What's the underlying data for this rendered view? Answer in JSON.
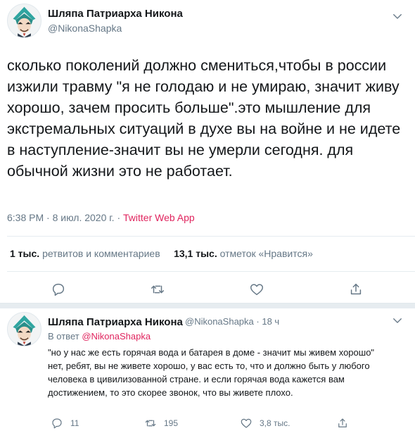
{
  "main_tweet": {
    "display_name": "Шляпа Патриарха Никона",
    "handle": "@NikonaShapka",
    "text": "сколько поколений должно смениться,чтобы в россии изжили травму \"я не голодаю и не умираю, значит живу хорошо, зачем просить больше\".это мышление для экстремальных ситуаций в духе вы на войне и не идете в наступление-значит вы не умерли сегодня. для обычной жизни это не работает.",
    "time": "6:38 PM",
    "date": "8 июл. 2020 г.",
    "separator": "·",
    "source": "Twitter Web App",
    "retweets_count": "1 тыс.",
    "retweets_label": "ретвитов и комментариев",
    "likes_count": "13,1 тыс.",
    "likes_label": "отметок «Нравится»",
    "icons": [
      "reply-icon",
      "retweet-icon",
      "like-icon",
      "share-icon",
      "chevron-down-icon"
    ]
  },
  "reply_tweet": {
    "display_name": "Шляпа Патриарха Никона",
    "handle": "@NikonaShapka",
    "separator": "·",
    "age": "18 ч",
    "in_reply_prefix": "В ответ",
    "in_reply_to": "@NikonaShapka",
    "line1": "\"но у нас же есть горячая вода и батарея в доме - значит мы живем хорошо\"",
    "line2": "нет, ребят, вы не живете хорошо, у вас есть то, что и должно быть у любого человека в цивилизованной стране. и если горячая вода кажется вам достижением, то это скорее звонок, что вы живете плохо.",
    "reply_count": "11",
    "retweet_count": "195",
    "like_count": "3,8 тыс."
  },
  "colors": {
    "text": "#14171a",
    "secondary": "#657786",
    "accent": "#e0245e",
    "divider": "#e6ecf0"
  }
}
